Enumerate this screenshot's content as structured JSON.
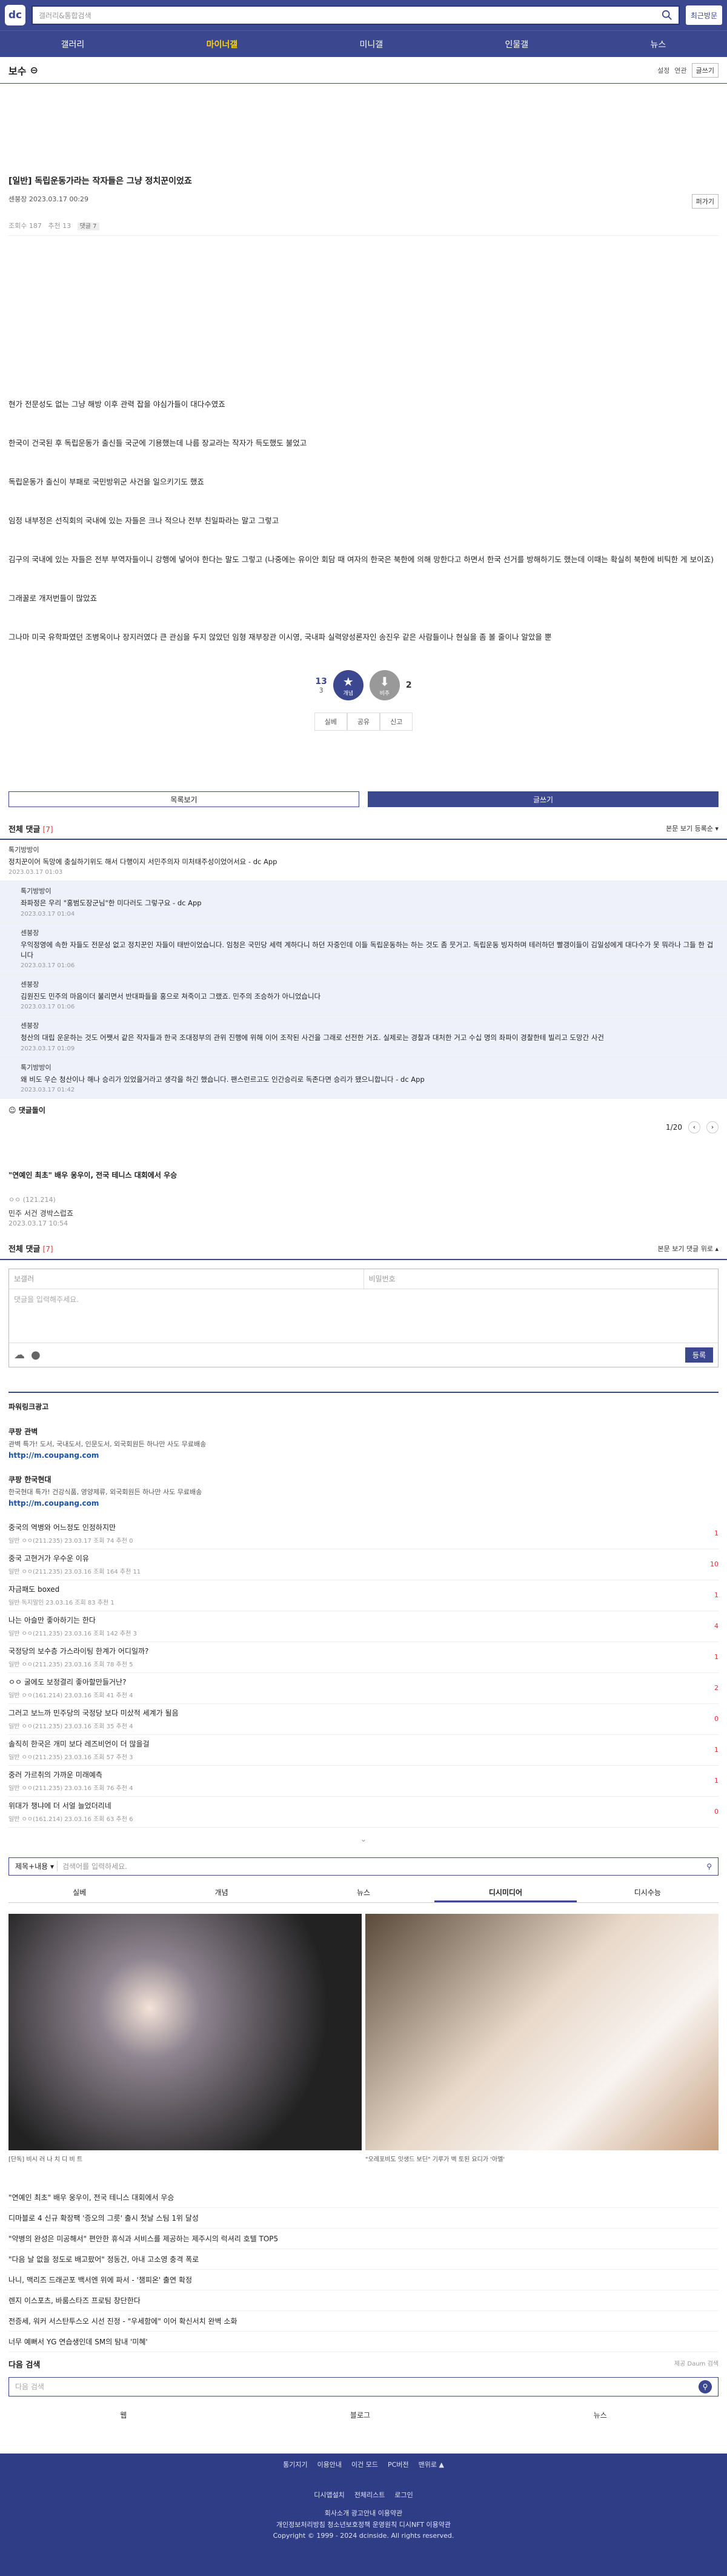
{
  "topbar": {
    "logo": "dc",
    "search_placeholder": "갤러리&통합검색",
    "recent_label": "최근방문"
  },
  "nav": {
    "items": [
      "갤러리",
      "마이너갤",
      "미니갤",
      "인물갤",
      "뉴스"
    ],
    "active": 1
  },
  "gallery": {
    "name": "보수",
    "opt1": "설정",
    "opt2": "연관",
    "write": "글쓰기"
  },
  "post": {
    "title": "[일반] 독립운동가라는 작자들은 그냥 정치꾼이었죠",
    "author": "센붕장",
    "date": "2023.03.17 00:29",
    "clip": "퍼가기",
    "views": "조회수 187",
    "recommend": "추천 13",
    "comments": "댓글 7",
    "body": [
      "현가 전문성도 없는 그냥 해방 이후 관력 잡을 야심가들이 대다수였죠",
      "한국이 건국된 후 독립운동가 출신들 국군에 기용했는데 나름 장교라는 작자가 득도했도 불었고",
      "독립운동가 출신이 부패로 국민방위군 사건을 일으키기도 했죠",
      "임정 내부정은 선직회의 국내에 있는 자들은 크나 적으나 전부 친일파라는 말고 그렇고",
      "김구의 국내에 있는 자들은 전부 부역자들이니 강행에 넣어야 한다는 말도 그렇고 (나중에는 유이안 회담 때 여자의 한국은 북한에 의해 망한다고 하면서 한국 선거를 방해하기도 했는데 이때는 확실히 북한에 비틱한 게 보이죠)",
      "그래꿀로 개저번들이 많았죠",
      "그나마 미국 유학파였던 조병옥이나 장지러였다 큰 관심을 두지 않았던 임형 재부장관 이시영, 국내파 실력양성론자인 송진우 같은 사람들이나 현실을 좀 볼 줄이나 알았을 뿐"
    ],
    "up": "13",
    "up_fix": "3",
    "down": "2",
    "up_label": "개념",
    "down_label": "비추",
    "share": [
      "실베",
      "공유",
      "신고"
    ]
  },
  "buttons": {
    "list": "목록보기",
    "write": "글쓰기"
  },
  "comments": {
    "title": "전체 댓글",
    "count": "[7]",
    "opts": "본문 보기  등록순 ▾",
    "items": [
      {
        "nick": "톡기방방이",
        "text": "정치꾼이어 독망에 충실하기위도 해서 다행이지 서민주의자 미처태주성이었어서요 - dc App",
        "date": "2023.03.17 01:03",
        "re": false
      },
      {
        "nick": "톡기방방이",
        "text": "좌파정은 우리 \"홍범도장군님\"한 미다러도 그렇구요 - dc App",
        "date": "2023.03.17 01:04",
        "re": true
      },
      {
        "nick": "센붕장",
        "text": "우익정영에 속한 자들도 전문성 없고 정치꾼인 자들이 태반이었습니다. 임청은 국민당 세력 계하다니 하던 자중인데 이들 독립운동하는 하는 것도 좀 뭇거고. 독립운동 빙자하며 테러하던 빨갱이들이 김일성에게 대다수가 못 뭐라나 그들 한 겁니다",
        "date": "2023.03.17 01:06",
        "re": true
      },
      {
        "nick": "센붕장",
        "text": "김원진도 민주의 마음이더 불리면서 반대파들을 홍으로 쳐죽이고 그랬죠. 민주의 조승하가 아니었습니다",
        "date": "2023.03.17 01:06",
        "re": true
      },
      {
        "nick": "센붕장",
        "text": "청산의 대립 운운하는 것도 어쨋서 같은 작자들과 한국 조대정부의 관위 진행에 위해 이어 조작된 사건을 그래로 선전한 거죠. 실제로는 경찰과 대처한 거고 수십 명의 좌파이 경찰한테 빌리고 도망간 사건",
        "date": "2023.03.17 01:09",
        "re": true
      },
      {
        "nick": "톡기방방이",
        "text": "왜 비도 우슨 청산이나 해나 승리가 있었을거라고 생각을 하긴 했습니다. 팬스런르고도 인간승리로 독존다면 승리가 됐으니합니다 - dc App",
        "date": "2023.03.17 01:42",
        "re": true
      }
    ],
    "dccon": "댓글돌이",
    "page": "1/20"
  },
  "promo": {
    "title": "\"연예인 최초\" 배우 웅우이, 전국 테니스 대회에서 우승",
    "meta": "ㅇㅇ (121.214)",
    "sub": "민주 서건 경박스럽죠",
    "sub_date": "2023.03.17 10:54"
  },
  "cform": {
    "title": "전체 댓글",
    "count": "[7]",
    "opts": "본문 보기  댓글 위로 ▴",
    "nick_ph": "보갤러",
    "pw_ph": "비밀번호",
    "text_ph": "댓글을 입력해주세요.",
    "submit": "등록"
  },
  "power": {
    "title": "파워링크광고",
    "ads": [
      {
        "name": "쿠팡 관벽",
        "desc": "관벽 특가! 도서, 국내도서, 인문도서, 외국회원든 하나만 사도 무료배송",
        "url": "http://m.coupang.com"
      },
      {
        "name": "쿠팡 한국현대",
        "desc": "한국현대 특가! 건강식품, 영양제류, 외국회원든 하나만 사도 무료배송",
        "url": "http://m.coupang.com"
      }
    ]
  },
  "posts": [
    {
      "t": "중국의 역병와 어느정도 인정하지만",
      "m": "일반  ㅇㅇ(211.235)  23.03.17  조회 74  추천 0",
      "c": "1"
    },
    {
      "t": "중국 고현거가 우수운 이유",
      "m": "일반  ㅇㅇ(211.235)  23.03.16  조회 164  추천 11",
      "c": "10"
    },
    {
      "t": "자금패도 boxed",
      "m": "일반  독지말인  23.03.16  조회 83  추천 1",
      "c": "1"
    },
    {
      "t": "나는 아슬만 좋아하기는 한다",
      "m": "일반  ㅇㅇ(211.235)  23.03.16  조회 142  추천 3",
      "c": "4"
    },
    {
      "t": "국정당의 보수층 가스라이팅 한계가 어디일까?",
      "m": "일반  ㅇㅇ(211.235)  23.03.16  조회 78  추천 5",
      "c": "1"
    },
    {
      "t": "ㅇㅇ 굴에도 보정결리 좋아할만들거난?",
      "m": "일반  ㅇㅇ(161.214)  23.03.16  조회 41  추천 4",
      "c": "2"
    },
    {
      "t": "그러고 보느까 민주당의 국정당 보다 미샀적 세계가 될음",
      "m": "일반  ㅇㅇ(211.235)  23.03.16  조회 35  추천 4",
      "c": "0"
    },
    {
      "t": "솔직히 한국은 개미 보다 레즈비언이 더 많을걸",
      "m": "일반  ㅇㅇ(211.235)  23.03.16  조회 57  추천 3",
      "c": "1"
    },
    {
      "t": "중러 가르취의 가까운 미래예측",
      "m": "일반  ㅇㅇ(211.235)  23.03.16  조회 76  추천 4",
      "c": "1"
    },
    {
      "t": "위대가 챙냐에 더 서얼 늘었더리네",
      "m": "일반  ㅇㅇ(161.214)  23.03.16  조회 63  추천 6",
      "c": "0"
    }
  ],
  "bsearch": {
    "select": "제목+내용 ▾",
    "placeholder": "검색어를 입력하세요."
  },
  "tabs2": [
    "실베",
    "개념",
    "뉴스",
    "디시미디어",
    "디시수능"
  ],
  "tabs2_active": 3,
  "images": [
    {
      "cap": "[단독] 비시 러 나 치 디 비 트"
    },
    {
      "cap": "\"오레포비도 잇생드 보딘\" 기루가 벽 토된 요디가 '아멜'"
    }
  ],
  "news": [
    "\"연예인 최초\" 배우 웅우이, 전국 테니스 대회에서 우승",
    "디마블로 4 신규 확장팩 '증오의 그릇' 출시 첫날 스팀 1위 달성",
    "\"약병의 완성은 미공해서\" 편안한 휴식과 서비스를 제공하는 제주시의 럭셔리 호텔 TOP5",
    "\"다음 날 없을 정도로 배고팠어\" 정동건, 아내 고소영 충격 폭로",
    "나니, 맥리즈 드래곤포 백서엔 위에 파서 - '챔피온' 출연 확정",
    "렌지 이스포츠, 바룸스타즈 프로팀 창단한다",
    "전증세, 워커 서스탄투스오 시선 진정 - \"우세함에\" 이어 확신서치 완벽 소화",
    "너무 예뻐서 YG 연습생인데 SM의 탐내 '미혜'"
  ],
  "dsearch": {
    "title": "다음 검색",
    "brand": "제공 Daum 검색",
    "placeholder": "다음 검색",
    "tabs": [
      "웹",
      "블로그",
      "뉴스"
    ]
  },
  "footer": {
    "links": [
      "통기지기",
      "이용안내",
      "이건 모드",
      "PC버전",
      "맨위로 ▲"
    ],
    "links2": [
      "디시앱설치",
      "전체리스트",
      "로그인"
    ],
    "line3": "회사소개   광고안내   이용약관",
    "line4": "개인정보처리방침   청소년보호정책   운영원칙   디시NFT 이용약관",
    "copy": "Copyright © 1999 - 2024 dcinside. All rights reserved."
  }
}
